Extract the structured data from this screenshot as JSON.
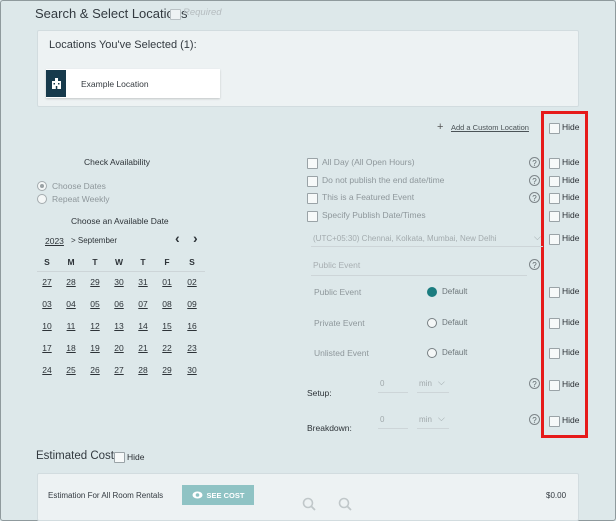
{
  "header": {
    "title": "Search & Select Locations",
    "required_label": "Required"
  },
  "selected": {
    "title": "Locations You've Selected (1):",
    "location_name": "Example Location"
  },
  "custom_location": {
    "plus": "+",
    "link": "Add a Custom Location"
  },
  "hide_label": "Hide",
  "availability": {
    "title": "Check Availability",
    "choose_dates": "Choose Dates",
    "repeat_weekly": "Repeat Weekly",
    "choose_date_title": "Choose an Available Date",
    "year": "2023",
    "month": "> September",
    "prev": "‹",
    "next": "›",
    "weekdays": [
      "S",
      "M",
      "T",
      "W",
      "T",
      "F",
      "S"
    ],
    "weeks": [
      [
        "27",
        "28",
        "29",
        "30",
        "31",
        "01",
        "02"
      ],
      [
        "03",
        "04",
        "05",
        "06",
        "07",
        "08",
        "09"
      ],
      [
        "10",
        "11",
        "12",
        "13",
        "14",
        "15",
        "16"
      ],
      [
        "17",
        "18",
        "19",
        "20",
        "21",
        "22",
        "23"
      ],
      [
        "24",
        "25",
        "26",
        "27",
        "28",
        "29",
        "30"
      ]
    ]
  },
  "options": {
    "all_day": "All Day (All Open Hours)",
    "no_publish_end": "Do not publish the end date/time",
    "featured": "This is a Featured Event",
    "publish_date": "Specify Publish Date/Times",
    "timezone": "(UTC+05:30) Chennai, Kolkata, Mumbai, New Delhi",
    "event_type_placeholder": "Public Event",
    "public_event": "Public Event",
    "private_event": "Private Event",
    "unlisted_event": "Unlisted Event",
    "default": "Default",
    "setup_label": "Setup:",
    "breakdown_label": "Breakdown:",
    "setup_value": "0",
    "breakdown_value": "0",
    "unit": "min"
  },
  "estimated": {
    "title": "Estimated Cost",
    "row_label": "Estimation For All Room Rentals",
    "see_cost": "SEE COST",
    "amount": "$0.00"
  }
}
